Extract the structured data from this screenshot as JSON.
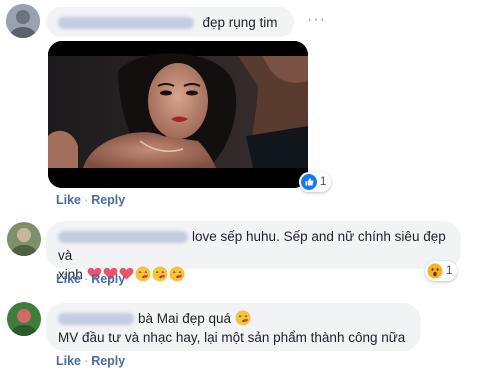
{
  "comments": [
    {
      "author": "",
      "text": "đẹp rụng tim",
      "like_label": "Like",
      "reply_label": "Reply",
      "reaction": {
        "icon": "like-icon",
        "count": "1",
        "color": "#1877f2"
      },
      "more_icon": "···"
    },
    {
      "author": "",
      "text_line1": "love sếp huhu. Sếp and nữ chính siêu đẹp và",
      "text_line2": "xinh",
      "emoji": [
        "heart-icon",
        "heart-icon",
        "heart-icon",
        "kiss-face-icon",
        "kiss-face-icon",
        "kiss-face-icon"
      ],
      "like_label": "Like",
      "reply_label": "Reply",
      "reaction": {
        "icon": "wow-icon",
        "count": "1",
        "color": "#f7b125"
      }
    },
    {
      "author": "",
      "text_line1": "bà Mai đẹp quá",
      "text_line2": "MV đầu tư và nhạc hay, lại một sản phẩm thành công nữa",
      "emoji": [
        "kiss-face-icon"
      ],
      "like_label": "Like",
      "reply_label": "Reply"
    }
  ],
  "colors": {
    "link": "#4b6aa8",
    "bubble": "#f2f3f5",
    "heart": "#f25268",
    "like_blue": "#1877f2"
  }
}
